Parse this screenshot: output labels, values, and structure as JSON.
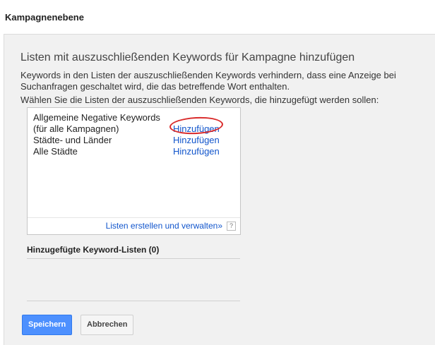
{
  "header": {
    "title": "Kampagnenebene"
  },
  "panel": {
    "heading": "Listen mit auszuschließenden Keywords für Kampagne hinzufügen",
    "description": "Keywords in den Listen der auszuschließenden Keywords verhindern, dass eine Anzeige bei Suchanfragen geschaltet wird, die das betreffende Wort enthalten.",
    "instruction": "Wählen Sie die Listen der auszuschließenden Keywords, die hinzugefügt werden sollen:"
  },
  "keyword_lists": {
    "items": [
      {
        "name": "Allgemeine Negative Keywords (für alle Kampagnen)",
        "action": "Hinzufügen",
        "highlighted": true
      },
      {
        "name": "Städte- und Länder",
        "action": "Hinzufügen"
      },
      {
        "name": "Alle Städte",
        "action": "Hinzufügen"
      }
    ],
    "manage_link": "Listen erstellen und verwalten»",
    "help_icon": "?"
  },
  "added_lists": {
    "title": "Hinzugefügte Keyword-Listen (0)"
  },
  "buttons": {
    "save": "Speichern",
    "cancel": "Abbrechen"
  },
  "colors": {
    "link": "#1155cc",
    "primary_button": "#4d90fe",
    "highlight_ring": "#d92a2a"
  }
}
